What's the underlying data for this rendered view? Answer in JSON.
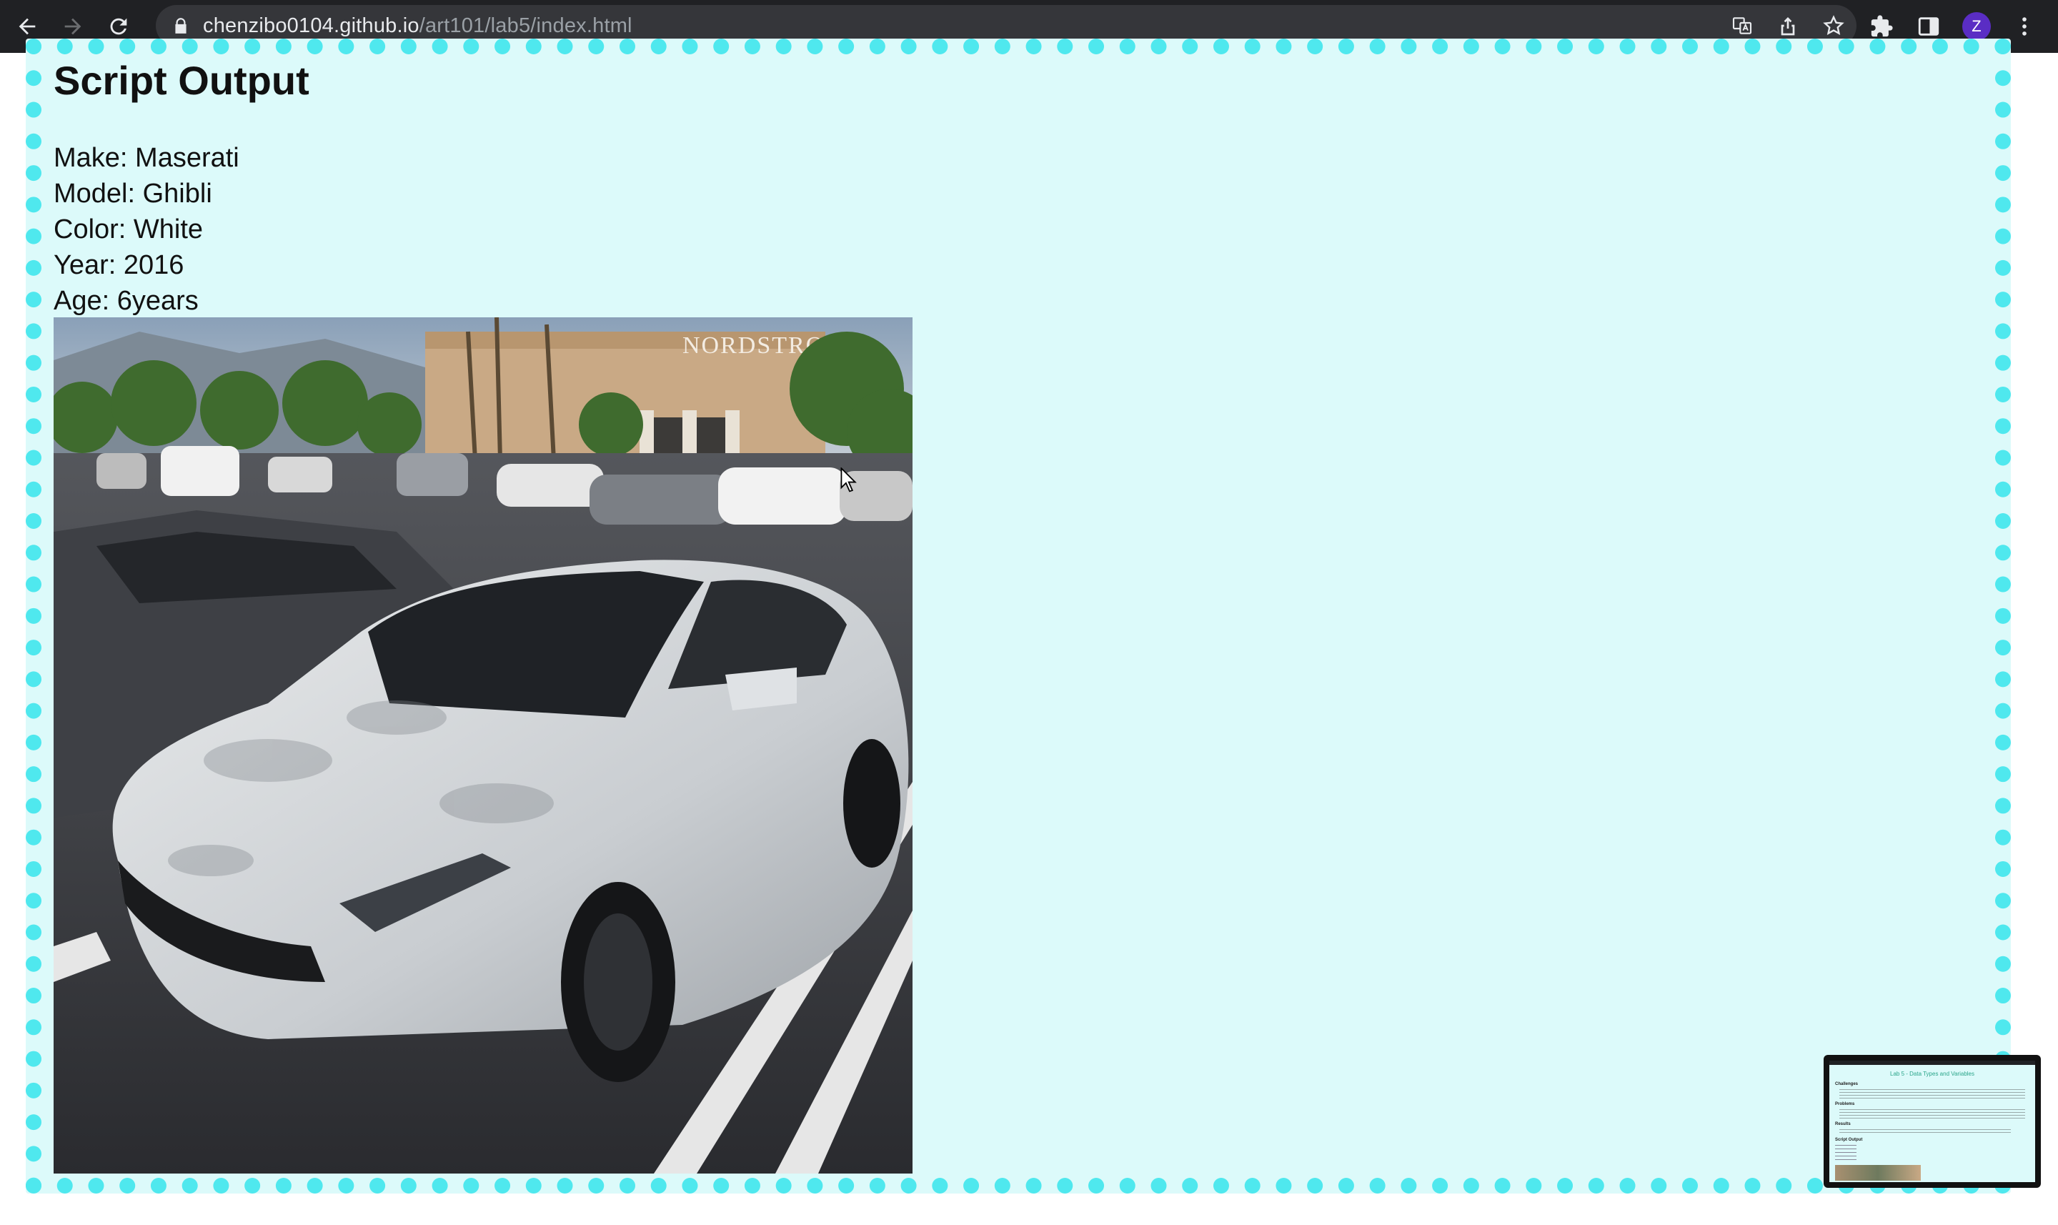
{
  "browser": {
    "url_domain": "chenzibo0104.github.io",
    "url_path": "/art101/lab5/index.html",
    "avatar_letter": "Z"
  },
  "page": {
    "heading": "Script Output",
    "info": [
      "Make: Maserati",
      "Model: Ghibli",
      "Color: White",
      "Year: 2016",
      "Age: 6years"
    ],
    "photo_sign": "NORDSTROM"
  },
  "preview": {
    "title": "Lab 5 - Data Types and Variables",
    "sections": [
      "Challenges",
      "Problems",
      "Results",
      "Script Output"
    ]
  },
  "colors": {
    "panel_bg": "#dcfafa",
    "border_dots": "#4fe8ee",
    "chrome": "#202124"
  }
}
